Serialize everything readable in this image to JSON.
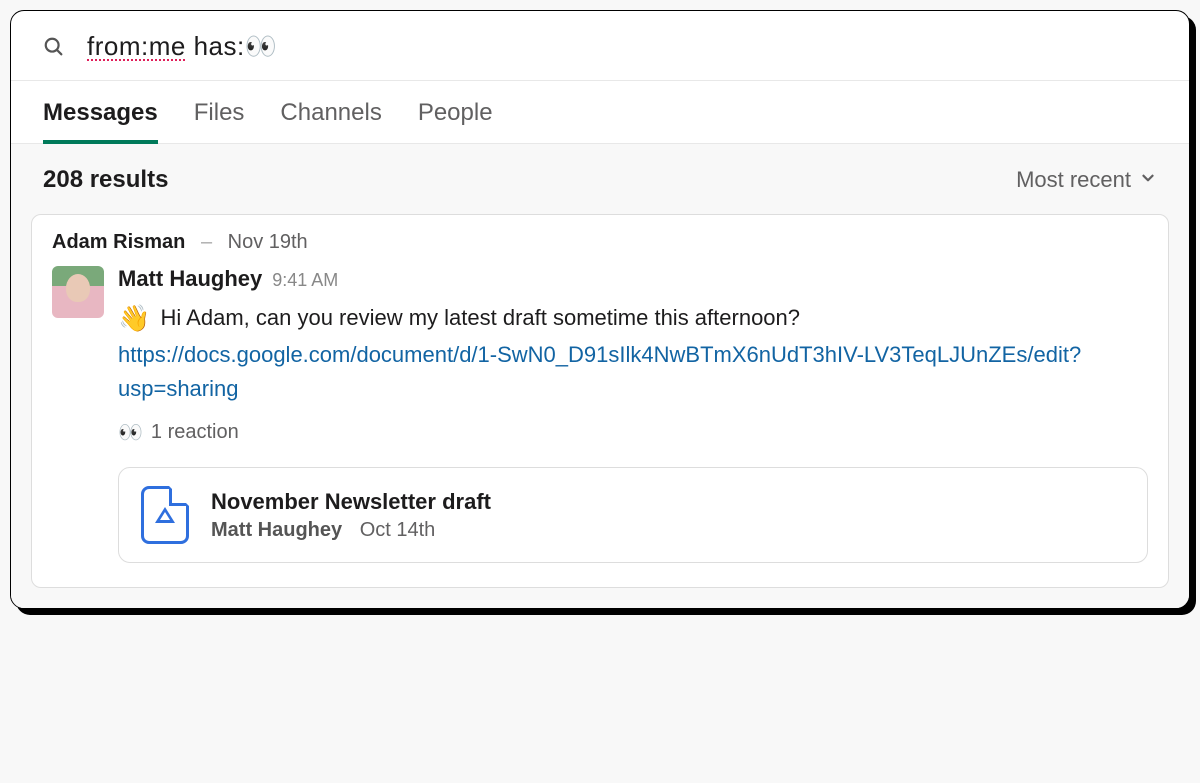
{
  "search": {
    "query_prefix": "from:me",
    "query_suffix": " has:",
    "query_emoji": "👀"
  },
  "tabs": {
    "messages": "Messages",
    "files": "Files",
    "channels": "Channels",
    "people": "People"
  },
  "results": {
    "count_text": "208 results",
    "sort_label": "Most recent"
  },
  "card": {
    "context_author": "Adam Risman",
    "context_date": "Nov 19th",
    "author": "Matt Haughey",
    "time": "9:41 AM",
    "leading_emoji": "👋",
    "text": "Hi Adam, can you review my latest draft sometime this afternoon?",
    "link": "https://docs.google.com/document/d/1-SwN0_D91sIlk4NwBTmX6nUdT3hIV-LV3TeqLJUnZEs/edit?usp=sharing",
    "reaction_emoji": "👀",
    "reaction_text": "1 reaction",
    "attachment": {
      "title": "November Newsletter draft",
      "author": "Matt Haughey",
      "date": "Oct 14th"
    }
  }
}
